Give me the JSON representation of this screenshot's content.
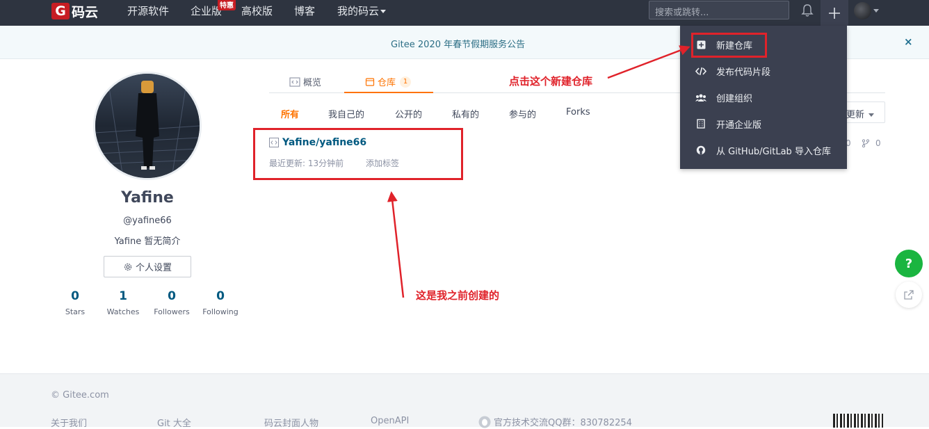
{
  "nav": {
    "logo_letter": "G",
    "logo_text": "码云",
    "items": [
      "开源软件",
      "企业版",
      "高校版",
      "博客",
      "我的码云"
    ],
    "hot_badge": "特惠",
    "search_placeholder": "搜索或跳转..."
  },
  "announcement": {
    "text": "Gitee 2020 年春节假期服务公告",
    "close": "×"
  },
  "profile": {
    "name": "Yafine",
    "handle": "@yafine66",
    "bio": "Yafine 暂无简介",
    "settings_label": "个人设置",
    "stats": [
      {
        "value": "0",
        "label": "Stars"
      },
      {
        "value": "1",
        "label": "Watches"
      },
      {
        "value": "0",
        "label": "Followers"
      },
      {
        "value": "0",
        "label": "Following"
      }
    ]
  },
  "tabs": {
    "overview": "概览",
    "repos": "仓库",
    "repos_count": "1"
  },
  "filters": [
    "所有",
    "我自己的",
    "公开的",
    "私有的",
    "参与的",
    "Forks"
  ],
  "sort_label": "更新",
  "repo": {
    "name": "Yafine/yafine66",
    "updated": "最近更新: 13分钟前",
    "add_tag": "添加标签",
    "stars": "0",
    "forks": "0"
  },
  "dropdown": {
    "items": [
      "新建仓库",
      "发布代码片段",
      "创建组织",
      "开通企业版",
      "从 GitHub/GitLab 导入仓库"
    ]
  },
  "annotations": {
    "new_repo": "点击这个新建仓库",
    "created_before": "这是我之前创建的"
  },
  "help_label": "?",
  "footer": {
    "copyright": "© Gitee.com",
    "links": [
      "关于我们",
      "Git 大全",
      "码云封面人物",
      "OpenAPI"
    ],
    "qq": "官方技术交流QQ群：830782254"
  },
  "colors": {
    "nav_bg": "#2e3440",
    "brand_red": "#c71d23",
    "accent_orange": "#fe7300",
    "link_blue": "#005980",
    "annotation_red": "#e0222a",
    "help_green": "#1ab540"
  }
}
